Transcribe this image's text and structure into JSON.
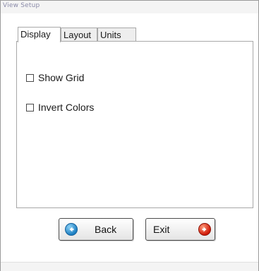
{
  "window": {
    "title": "View Setup"
  },
  "tabs": [
    {
      "label": "Display",
      "active": true
    },
    {
      "label": "Layout",
      "active": false
    },
    {
      "label": "Units",
      "active": false
    }
  ],
  "options": [
    {
      "label": "Show Grid",
      "checked": false
    },
    {
      "label": "Invert Colors",
      "checked": false
    }
  ],
  "buttons": {
    "back_label": "Back",
    "exit_label": "Exit"
  },
  "colors": {
    "back_icon": "#1c7fc2",
    "exit_icon": "#d01a08"
  },
  "icons": {
    "back": "arrow-left-circle-icon",
    "exit": "arrow-right-circle-icon"
  }
}
